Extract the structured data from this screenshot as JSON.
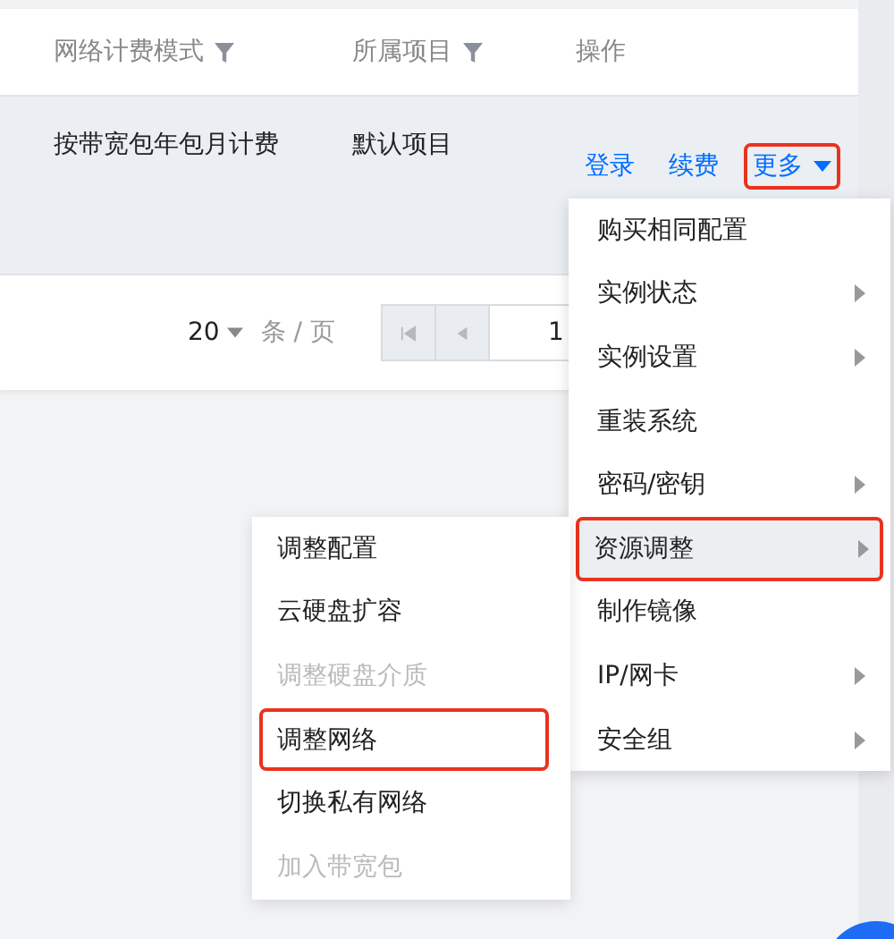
{
  "table": {
    "columns": [
      {
        "label": "网络计费模式",
        "filter": true
      },
      {
        "label": "所属项目",
        "filter": true
      },
      {
        "label": "操作"
      }
    ],
    "rows": [
      {
        "hovered": true,
        "cells": [
          "按带宽包年包月计费",
          "默认项目"
        ],
        "actions": [
          {
            "label": "登录",
            "dropdown": false,
            "highlighted": false
          },
          {
            "label": "续费",
            "dropdown": false,
            "highlighted": false
          },
          {
            "label": "更多",
            "dropdown": true,
            "highlighted": true
          }
        ]
      }
    ]
  },
  "pagination": {
    "page_size": "20",
    "per_page_label": "条 / 页",
    "page": "1"
  },
  "menu": {
    "items": [
      {
        "label": "购买相同配置",
        "submenu": false,
        "selected": false,
        "highlighted": false
      },
      {
        "label": "实例状态",
        "submenu": true,
        "selected": false,
        "highlighted": false
      },
      {
        "label": "实例设置",
        "submenu": true,
        "selected": false,
        "highlighted": false
      },
      {
        "label": "重装系统",
        "submenu": false,
        "selected": false,
        "highlighted": false
      },
      {
        "label": "密码/密钥",
        "submenu": true,
        "selected": false,
        "highlighted": false
      },
      {
        "label": "资源调整",
        "submenu": true,
        "selected": true,
        "highlighted": true
      },
      {
        "label": "制作镜像",
        "submenu": false,
        "selected": false,
        "highlighted": false
      },
      {
        "label": "IP/网卡",
        "submenu": true,
        "selected": false,
        "highlighted": false
      },
      {
        "label": "安全组",
        "submenu": true,
        "selected": false,
        "highlighted": false
      }
    ]
  },
  "submenu": {
    "items": [
      {
        "label": "调整配置",
        "disabled": false,
        "highlighted": false
      },
      {
        "label": "云硬盘扩容",
        "disabled": false,
        "highlighted": false
      },
      {
        "label": "调整硬盘介质",
        "disabled": true,
        "highlighted": false
      },
      {
        "label": "调整网络",
        "disabled": false,
        "highlighted": true
      },
      {
        "label": "切换私有网络",
        "disabled": false,
        "highlighted": false
      },
      {
        "label": "加入带宽包",
        "disabled": true,
        "highlighted": false
      }
    ]
  }
}
